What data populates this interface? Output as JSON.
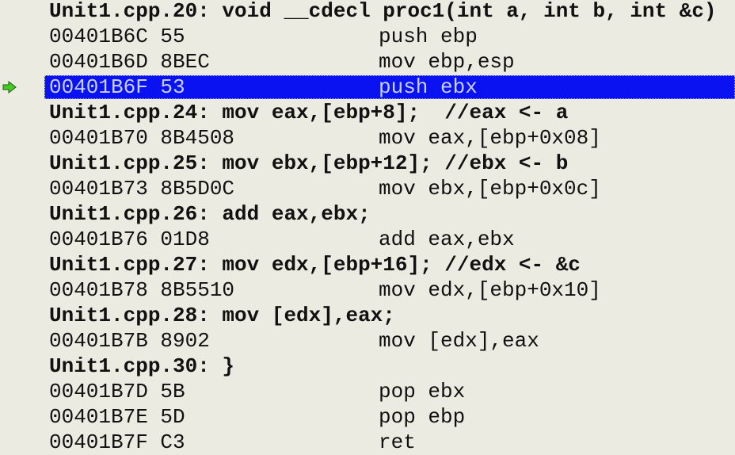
{
  "current_line_indicator": "green-arrow-icon",
  "colors": {
    "selection": "#0a12f2",
    "background": "#ecebe1",
    "arrow": "#44cc22"
  },
  "lines": [
    {
      "type": "source",
      "text": "Unit1.cpp.20: void __cdecl proc1(int a, int b, int &c)"
    },
    {
      "type": "asm",
      "address": "00401B6C 55",
      "instruction": "push ebp"
    },
    {
      "type": "asm",
      "address": "00401B6D 8BEC",
      "instruction": "mov ebp,esp"
    },
    {
      "type": "asm",
      "address": "00401B6F 53",
      "instruction": "push ebx",
      "selected": true
    },
    {
      "type": "source",
      "text": "Unit1.cpp.24: mov eax,[ebp+8];  //eax <- a"
    },
    {
      "type": "asm",
      "address": "00401B70 8B4508",
      "instruction": "mov eax,[ebp+0x08]"
    },
    {
      "type": "source",
      "text": "Unit1.cpp.25: mov ebx,[ebp+12]; //ebx <- b"
    },
    {
      "type": "asm",
      "address": "00401B73 8B5D0C",
      "instruction": "mov ebx,[ebp+0x0c]"
    },
    {
      "type": "source",
      "text": "Unit1.cpp.26: add eax,ebx;"
    },
    {
      "type": "asm",
      "address": "00401B76 01D8",
      "instruction": "add eax,ebx"
    },
    {
      "type": "source",
      "text": "Unit1.cpp.27: mov edx,[ebp+16]; //edx <- &c"
    },
    {
      "type": "asm",
      "address": "00401B78 8B5510",
      "instruction": "mov edx,[ebp+0x10]"
    },
    {
      "type": "source",
      "text": "Unit1.cpp.28: mov [edx],eax;"
    },
    {
      "type": "asm",
      "address": "00401B7B 8902",
      "instruction": "mov [edx],eax"
    },
    {
      "type": "source",
      "text": "Unit1.cpp.30: }"
    },
    {
      "type": "asm",
      "address": "00401B7D 5B",
      "instruction": "pop ebx"
    },
    {
      "type": "asm",
      "address": "00401B7E 5D",
      "instruction": "pop ebp"
    },
    {
      "type": "asm",
      "address": "00401B7F C3",
      "instruction": "ret"
    }
  ]
}
